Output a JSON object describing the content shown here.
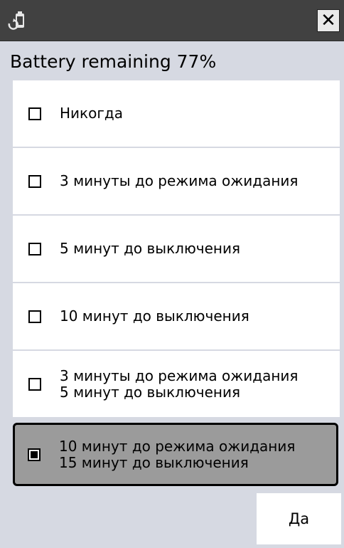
{
  "window": {
    "app_icon": "battery-recycle-icon",
    "close_icon": "close-icon",
    "close_glyph": "✕"
  },
  "header": {
    "title": "Battery remaining 77%"
  },
  "options": [
    {
      "lines": [
        "Никогда"
      ],
      "checked": false
    },
    {
      "lines": [
        "3 минуты до режима ожидания"
      ],
      "checked": false
    },
    {
      "lines": [
        "5 минут до выключения"
      ],
      "checked": false
    },
    {
      "lines": [
        "10 минут до выключения"
      ],
      "checked": false
    },
    {
      "lines": [
        "3 минуты до режима ожидания",
        "5 минут до выключения"
      ],
      "checked": false
    },
    {
      "lines": [
        "10 минут до режима ожидания",
        "15 минут до выключения"
      ],
      "checked": true
    }
  ],
  "footer": {
    "ok_label": "Да"
  },
  "colors": {
    "titlebar": "#414141",
    "background": "#d6d9e2",
    "item": "#ffffff",
    "selected_item": "#9b9b9b"
  }
}
